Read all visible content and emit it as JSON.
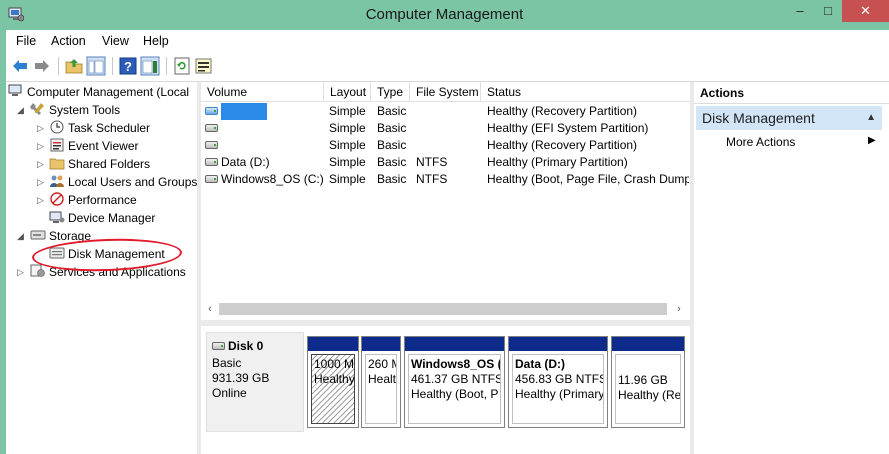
{
  "window": {
    "title": "Computer Management",
    "minimize": "–",
    "maximize": "□",
    "close": "✕"
  },
  "menu": [
    "File",
    "Action",
    "View",
    "Help"
  ],
  "toolbar_icons": [
    "back-arrow-icon",
    "forward-arrow-icon",
    "up-folder-icon",
    "show-hide-tree-icon",
    "help-icon",
    "show-hide-action-pane-icon",
    "refresh-icon",
    "properties-icon"
  ],
  "tree": {
    "root": "Computer Management (Local",
    "system_tools": "System Tools",
    "task_scheduler": "Task Scheduler",
    "event_viewer": "Event Viewer",
    "shared_folders": "Shared Folders",
    "local_users": "Local Users and Groups",
    "performance": "Performance",
    "device_manager": "Device Manager",
    "storage": "Storage",
    "disk_management": "Disk Management",
    "services": "Services and Applications"
  },
  "volumes": {
    "columns": [
      "Volume",
      "Layout",
      "Type",
      "File System",
      "Status"
    ],
    "rows": [
      {
        "volume": "",
        "layout": "Simple",
        "type": "Basic",
        "fs": "",
        "status": "Healthy (Recovery Partition)"
      },
      {
        "volume": "",
        "layout": "Simple",
        "type": "Basic",
        "fs": "",
        "status": "Healthy (EFI System Partition)"
      },
      {
        "volume": "",
        "layout": "Simple",
        "type": "Basic",
        "fs": "",
        "status": "Healthy (Recovery Partition)"
      },
      {
        "volume": "Data (D:)",
        "layout": "Simple",
        "type": "Basic",
        "fs": "NTFS",
        "status": "Healthy (Primary Partition)"
      },
      {
        "volume": "Windows8_OS (C:)",
        "layout": "Simple",
        "type": "Basic",
        "fs": "NTFS",
        "status": "Healthy (Boot, Page File, Crash Dump,"
      }
    ]
  },
  "scroll": {
    "left": "‹",
    "right": "›"
  },
  "disk": {
    "name": "Disk 0",
    "type": "Basic",
    "size": "931.39 GB",
    "state": "Online",
    "partitions": [
      {
        "title": "",
        "size": "1000 M",
        "status": "Healthy"
      },
      {
        "title": "",
        "size": "260 M",
        "status": "Healt"
      },
      {
        "title": "Windows8_OS (C",
        "size": "461.37 GB NTFS",
        "status": "Healthy (Boot, P"
      },
      {
        "title": "Data  (D:)",
        "size": "456.83 GB NTFS",
        "status": "Healthy (Primary"
      },
      {
        "title": "",
        "size": "11.96 GB",
        "status": "Healthy (Re"
      }
    ]
  },
  "actions": {
    "header": "Actions",
    "section": "Disk Management",
    "collapse": "▲",
    "item": "More Actions",
    "arrow": "▶"
  },
  "colors": {
    "titlebar": "#7bc4a4",
    "partition_band": "#0e2a8a",
    "selected_section": "#d3e6f7",
    "annotation": "#e0192b"
  }
}
